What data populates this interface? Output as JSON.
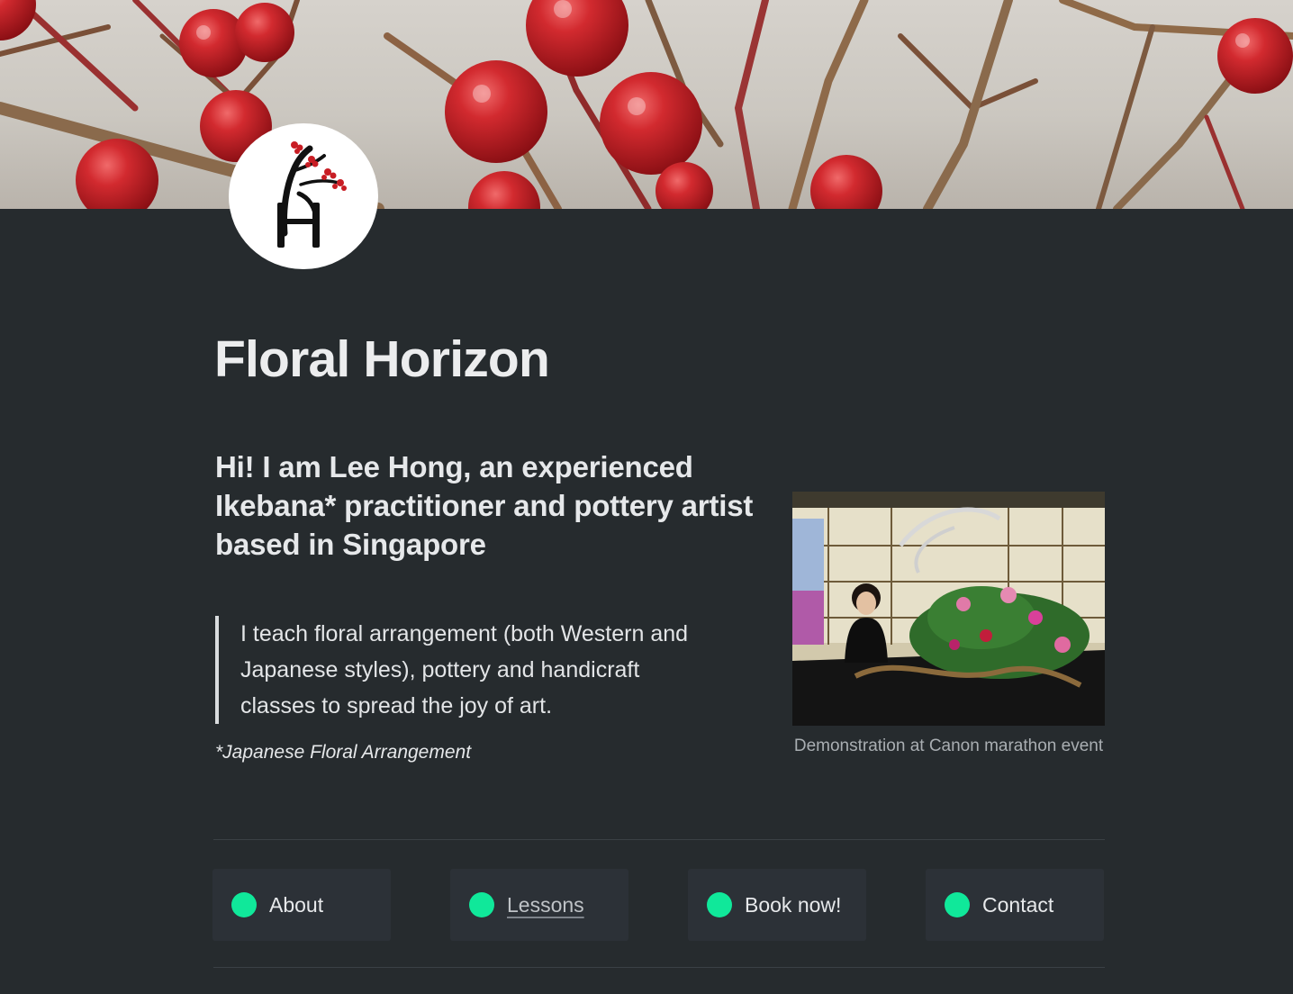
{
  "site": {
    "title": "Floral Horizon"
  },
  "intro": {
    "heading": "Hi! I am Lee Hong, an experienced Ikebana* practitioner and pottery artist based in Singapore",
    "quote": "I teach floral arrangement (both Western and Japanese styles), pottery and handicraft classes to spread the joy of art.",
    "footnote": "*Japanese Floral Arrangement"
  },
  "photo": {
    "caption": "Demonstration at Canon marathon event"
  },
  "nav": {
    "items": [
      {
        "label": "About",
        "icon": "green-dot-icon"
      },
      {
        "label": "Lessons",
        "icon": "green-dot-icon"
      },
      {
        "label": "Book now!",
        "icon": "green-dot-icon"
      },
      {
        "label": "Contact",
        "icon": "green-dot-icon"
      }
    ]
  },
  "colors": {
    "background": "#262b2e",
    "card": "#2c3137",
    "accent": "#10e89a",
    "berry": "#c81d24"
  }
}
